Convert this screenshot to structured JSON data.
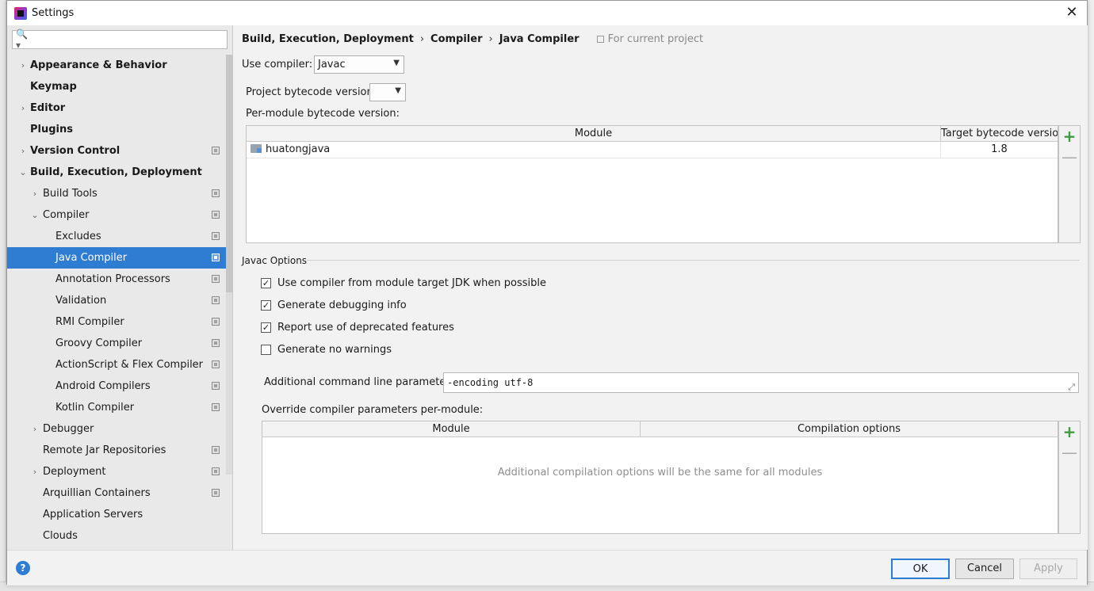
{
  "window": {
    "title": "Settings"
  },
  "sidebar": {
    "search_placeholder": "",
    "items": [
      {
        "label": "Appearance & Behavior",
        "level": 0,
        "bold": true,
        "arrow": "›",
        "project": false
      },
      {
        "label": "Keymap",
        "level": 0,
        "bold": true,
        "arrow": "",
        "project": false
      },
      {
        "label": "Editor",
        "level": 0,
        "bold": true,
        "arrow": "›",
        "project": false
      },
      {
        "label": "Plugins",
        "level": 0,
        "bold": true,
        "arrow": "",
        "project": false
      },
      {
        "label": "Version Control",
        "level": 0,
        "bold": true,
        "arrow": "›",
        "project": true
      },
      {
        "label": "Build, Execution, Deployment",
        "level": 0,
        "bold": true,
        "arrow": "⌄",
        "project": false
      },
      {
        "label": "Build Tools",
        "level": 1,
        "bold": false,
        "arrow": "›",
        "project": true
      },
      {
        "label": "Compiler",
        "level": 1,
        "bold": false,
        "arrow": "⌄",
        "project": true
      },
      {
        "label": "Excludes",
        "level": 2,
        "bold": false,
        "arrow": "",
        "project": true
      },
      {
        "label": "Java Compiler",
        "level": 2,
        "bold": false,
        "arrow": "",
        "project": true,
        "selected": true
      },
      {
        "label": "Annotation Processors",
        "level": 2,
        "bold": false,
        "arrow": "",
        "project": true
      },
      {
        "label": "Validation",
        "level": 2,
        "bold": false,
        "arrow": "",
        "project": true
      },
      {
        "label": "RMI Compiler",
        "level": 2,
        "bold": false,
        "arrow": "",
        "project": true
      },
      {
        "label": "Groovy Compiler",
        "level": 2,
        "bold": false,
        "arrow": "",
        "project": true
      },
      {
        "label": "ActionScript & Flex Compiler",
        "level": 2,
        "bold": false,
        "arrow": "",
        "project": true
      },
      {
        "label": "Android Compilers",
        "level": 2,
        "bold": false,
        "arrow": "",
        "project": true
      },
      {
        "label": "Kotlin Compiler",
        "level": 2,
        "bold": false,
        "arrow": "",
        "project": true
      },
      {
        "label": "Debugger",
        "level": 1,
        "bold": false,
        "arrow": "›",
        "project": false
      },
      {
        "label": "Remote Jar Repositories",
        "level": 1,
        "bold": false,
        "arrow": "",
        "project": true
      },
      {
        "label": "Deployment",
        "level": 1,
        "bold": false,
        "arrow": "›",
        "project": true
      },
      {
        "label": "Arquillian Containers",
        "level": 1,
        "bold": false,
        "arrow": "",
        "project": true
      },
      {
        "label": "Application Servers",
        "level": 1,
        "bold": false,
        "arrow": "",
        "project": false
      },
      {
        "label": "Clouds",
        "level": 1,
        "bold": false,
        "arrow": "",
        "project": false
      }
    ]
  },
  "breadcrumb": {
    "items": [
      "Build, Execution, Deployment",
      "Compiler",
      "Java Compiler"
    ],
    "separator": "›",
    "scope": "For current project"
  },
  "compiler": {
    "use_compiler_label": "Use compiler:",
    "use_compiler_value": "Javac",
    "project_bytecode_label": "Project bytecode version:",
    "project_bytecode_value": "",
    "per_module_label": "Per-module bytecode version:"
  },
  "module_table": {
    "columns": [
      "Module",
      "Target bytecode version"
    ],
    "rows": [
      {
        "module": "huatongjava",
        "target": "1.8"
      }
    ]
  },
  "javac_options": {
    "title": "Javac Options",
    "checkboxes": [
      {
        "label": "Use compiler from module target JDK when possible",
        "checked": true
      },
      {
        "label": "Generate debugging info",
        "checked": true
      },
      {
        "label": "Report use of deprecated features",
        "checked": true
      },
      {
        "label": "Generate no warnings",
        "checked": false
      }
    ],
    "additional_params_label": "Additional command line parameters:",
    "additional_params_value": "-encoding utf-8",
    "override_label": "Override compiler parameters per-module:"
  },
  "override_table": {
    "columns": [
      "Module",
      "Compilation options"
    ],
    "empty_text": "Additional compilation options will be the same for all modules"
  },
  "buttons": {
    "ok": "OK",
    "cancel": "Cancel",
    "apply": "Apply",
    "help": "?",
    "add": "+",
    "remove": "—"
  },
  "colors": {
    "selection": "#2f7cd3",
    "add_green": "#3f9b3f"
  }
}
